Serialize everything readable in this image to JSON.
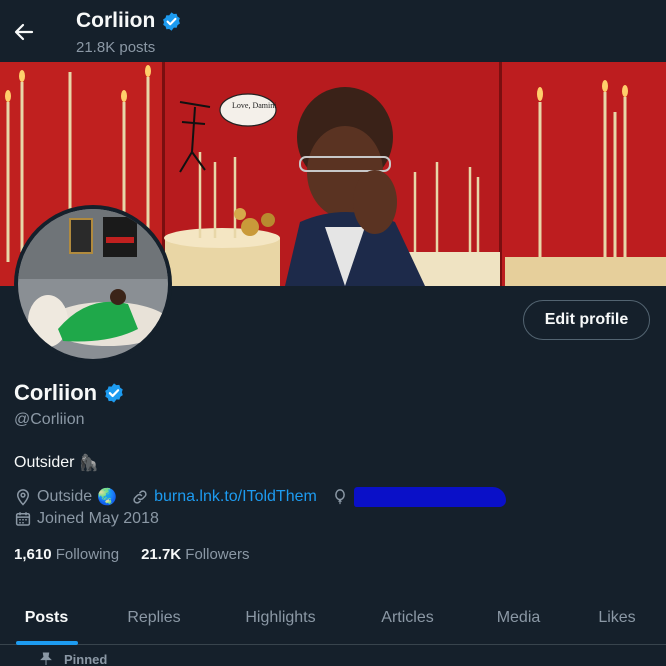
{
  "header": {
    "title": "Corliion",
    "post_count": "21.8K posts"
  },
  "banner": {
    "handwritten_note": "Love, Damini"
  },
  "profile": {
    "display_name": "Corliion",
    "handle": "@Corliion",
    "bio": "Outsider",
    "bio_emoji": "🦍",
    "location": "Outside",
    "location_emoji": "🌏",
    "link_text": "burna.lnk.to/IToldThem",
    "joined": "Joined May 2018",
    "following_count": "1,610",
    "following_label": "Following",
    "followers_count": "21.7K",
    "followers_label": "Followers",
    "edit_button": "Edit profile"
  },
  "tabs": [
    {
      "label": "Posts",
      "active": true
    },
    {
      "label": "Replies",
      "active": false
    },
    {
      "label": "Highlights",
      "active": false
    },
    {
      "label": "Articles",
      "active": false
    },
    {
      "label": "Media",
      "active": false
    },
    {
      "label": "Likes",
      "active": false
    }
  ],
  "pinned_label": "Pinned",
  "colors": {
    "background": "#15202b",
    "accent": "#1d9bf0",
    "muted_text": "#8b98a5",
    "banner_red": "#b81a1d",
    "redaction": "#0a10c8"
  }
}
